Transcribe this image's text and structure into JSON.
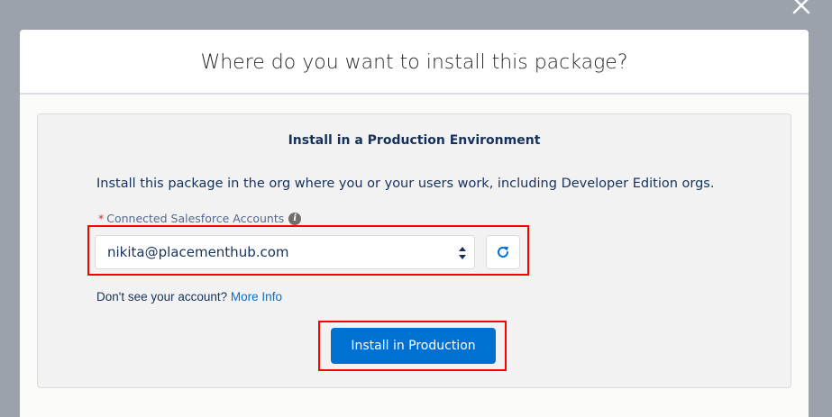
{
  "modal": {
    "title": "Where do you want to install this package?",
    "close_icon": "close-icon"
  },
  "card": {
    "heading": "Install in a Production Environment",
    "description": "Install this package in the org where you or your users work, including Developer Edition orgs.",
    "field": {
      "required_marker": "*",
      "label": "Connected Salesforce Accounts",
      "info_icon": "info-icon",
      "selected_value": "nikita@placementhub.com",
      "refresh_icon": "refresh-icon"
    },
    "help": {
      "text": "Don't see your account?",
      "link": "More Info"
    },
    "install_button_label": "Install in Production"
  },
  "colors": {
    "primary": "#0070d2",
    "highlight": "#ff0000",
    "overlay": "#9ba2ab"
  }
}
